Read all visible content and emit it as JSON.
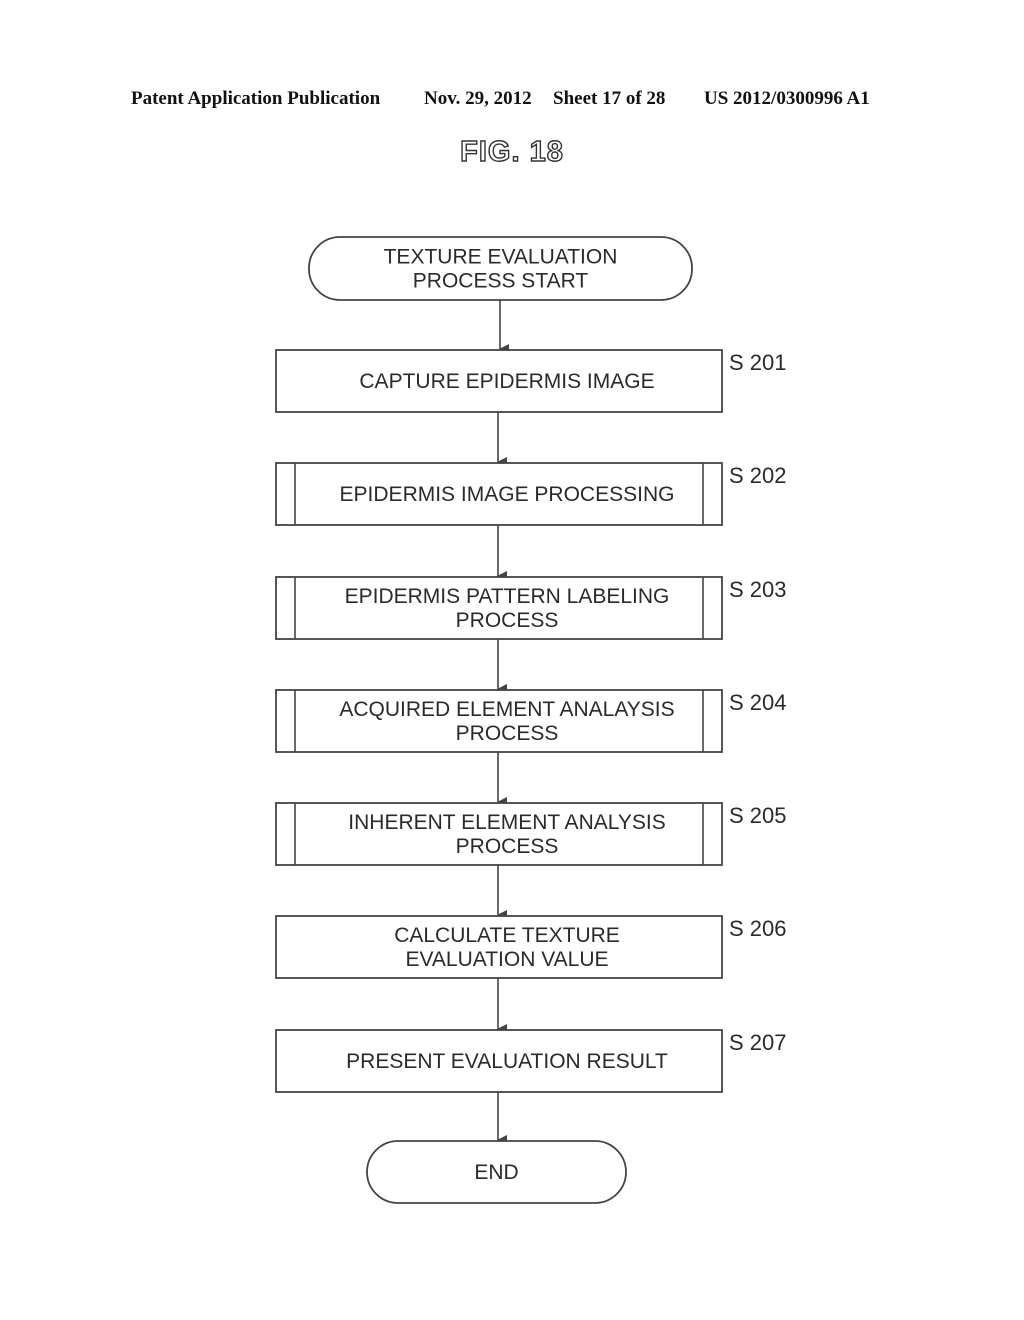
{
  "header": {
    "publication": "Patent Application Publication",
    "date": "Nov. 29, 2012",
    "sheet": "Sheet 17 of 28",
    "patent_number": "US 2012/0300996 A1"
  },
  "figure": {
    "title": "FIG. 18"
  },
  "flowchart": {
    "start": {
      "lines": [
        "TEXTURE EVALUATION",
        "PROCESS START"
      ]
    },
    "steps": [
      {
        "id": "S201",
        "label": "S 201",
        "type": "process",
        "lines": [
          "CAPTURE EPIDERMIS IMAGE"
        ]
      },
      {
        "id": "S202",
        "label": "S 202",
        "type": "subroutine",
        "lines": [
          "EPIDERMIS IMAGE PROCESSING"
        ]
      },
      {
        "id": "S203",
        "label": "S 203",
        "type": "subroutine",
        "lines": [
          "EPIDERMIS PATTERN LABELING",
          "PROCESS"
        ]
      },
      {
        "id": "S204",
        "label": "S 204",
        "type": "subroutine",
        "lines": [
          "ACQUIRED ELEMENT ANALAYSIS",
          "PROCESS"
        ]
      },
      {
        "id": "S205",
        "label": "S 205",
        "type": "subroutine",
        "lines": [
          "INHERENT ELEMENT ANALYSIS",
          "PROCESS"
        ]
      },
      {
        "id": "S206",
        "label": "S 206",
        "type": "process",
        "lines": [
          "CALCULATE TEXTURE",
          "EVALUATION VALUE"
        ]
      },
      {
        "id": "S207",
        "label": "S 207",
        "type": "process",
        "lines": [
          "PRESENT EVALUATION RESULT"
        ]
      }
    ],
    "end": {
      "lines": [
        "END"
      ]
    }
  }
}
